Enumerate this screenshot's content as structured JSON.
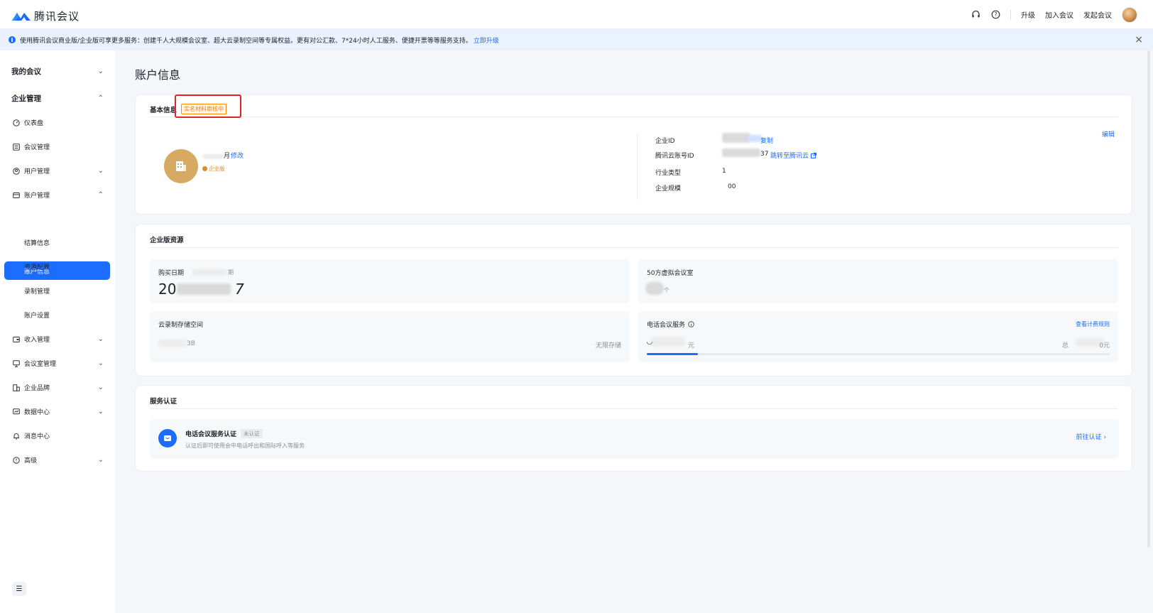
{
  "app": {
    "name": "腾讯会议"
  },
  "header": {
    "upgrade": "升级",
    "join": "加入会议",
    "start": "发起会议"
  },
  "notice": {
    "text": "使用腾讯会议商业版/企业版可享更多服务：创建千人大规模会议室、超大云录制空间等专属权益。更有对公汇款、7*24小时人工服务、便捷开票等等服务支持。",
    "link": "立即升级",
    "close": "×"
  },
  "sidebar": {
    "my_meetings": "我的会议",
    "enterprise": "企业管理",
    "items": [
      {
        "label": "仪表盘"
      },
      {
        "label": "会议管理"
      },
      {
        "label": "用户管理"
      },
      {
        "label": "账户管理"
      },
      {
        "label": "账户信息"
      },
      {
        "label": "结算信息"
      },
      {
        "label": "资源配置"
      },
      {
        "label": "录制管理"
      },
      {
        "label": "账户设置"
      },
      {
        "label": "收入管理"
      },
      {
        "label": "会议室管理"
      },
      {
        "label": "企业品牌"
      },
      {
        "label": "数据中心"
      },
      {
        "label": "消息中心"
      },
      {
        "label": "高级"
      }
    ]
  },
  "page": {
    "title": "账户信息"
  },
  "basic": {
    "title": "基本信息",
    "badge": "实名材料审核中",
    "name_suffix": "月",
    "edit_name": "修改",
    "tag": "企业版",
    "edit": "编辑",
    "fields": [
      {
        "label": "企业ID",
        "value": "",
        "action": "复制"
      },
      {
        "label": "腾讯云账号ID",
        "value": "37",
        "action": "跳转至腾讯云"
      },
      {
        "label": "行业类型",
        "value": "1"
      },
      {
        "label": "企业规模",
        "value": "00"
      }
    ]
  },
  "resources": {
    "title": "企业版资源",
    "purchase": {
      "label": "购买日期",
      "suffix": "期",
      "value": "20",
      "value_tail": "7"
    },
    "virtual_room": {
      "label": "50方虚拟会议室",
      "unit": "个"
    },
    "storage": {
      "label": "云录制存储空间",
      "used": "3B",
      "total": "无限存储"
    },
    "phone": {
      "label": "电话会议服务",
      "left": "元",
      "rule": "查看计费规则",
      "total_prefix": "总",
      "total_suffix": "0元",
      "progress": 0.11
    }
  },
  "service": {
    "title": "服务认证",
    "name": "电话会议服务认证",
    "status": "未认证",
    "desc": "认证后即可使用会中电话呼出和国际呼入等服务",
    "go": "前往认证"
  }
}
